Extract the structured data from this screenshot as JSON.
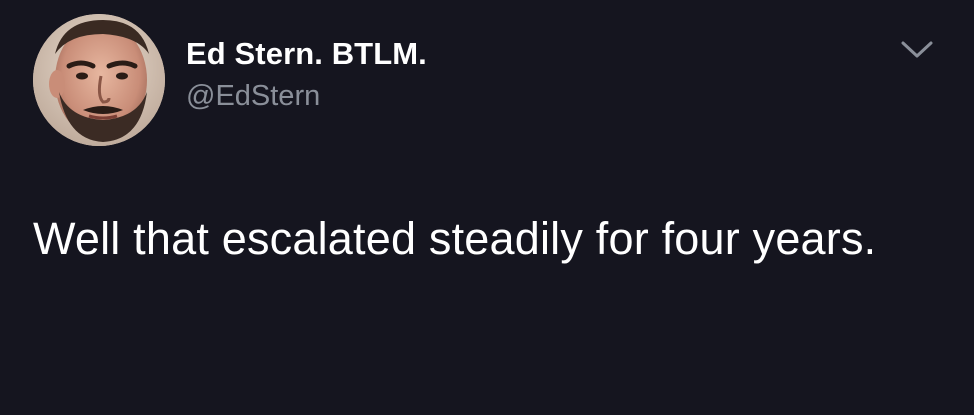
{
  "tweet": {
    "author": {
      "display_name": "Ed Stern. BTLM.",
      "handle": "@EdStern",
      "avatar_icon": "profile-photo"
    },
    "text": "Well that escalated steadily for four years.",
    "menu_icon": "chevron-down-icon"
  },
  "colors": {
    "background": "#15151f",
    "text_primary": "#ffffff",
    "text_secondary": "#8a8f99"
  }
}
